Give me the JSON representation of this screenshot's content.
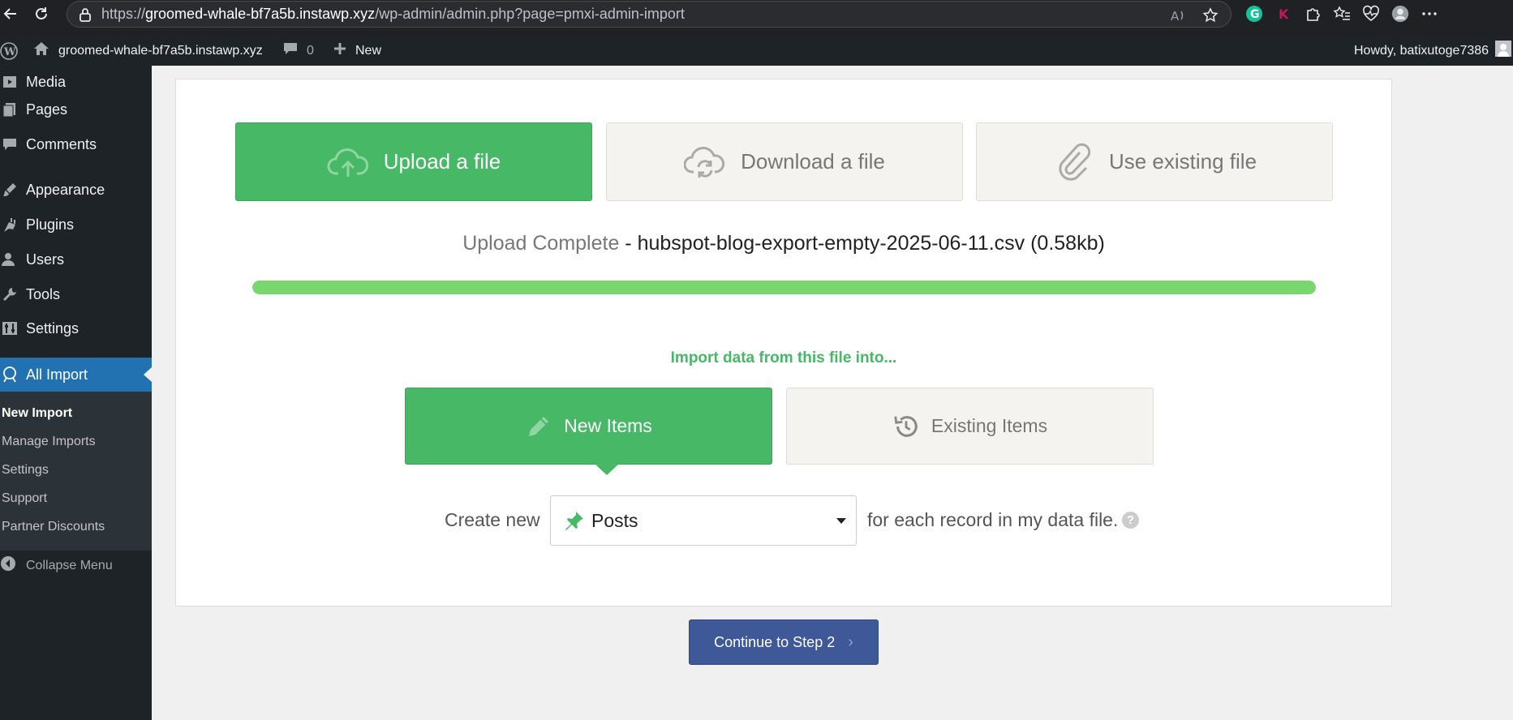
{
  "browser": {
    "url_scheme": "https://",
    "url_host": "groomed-whale-bf7a5b.instawp.xyz",
    "url_path": "/wp-admin/admin.php?page=pmxi-admin-import"
  },
  "admin_bar": {
    "site_name": "groomed-whale-bf7a5b.instawp.xyz",
    "comments_count": "0",
    "new_label": "New",
    "howdy": "Howdy, batixutoge7386"
  },
  "sidebar": {
    "items": [
      {
        "label": "Media",
        "icon": "media-icon"
      },
      {
        "label": "Pages",
        "icon": "pages-icon"
      },
      {
        "label": "Comments",
        "icon": "comments-icon"
      },
      {
        "label": "Appearance",
        "icon": "appearance-icon"
      },
      {
        "label": "Plugins",
        "icon": "plugins-icon"
      },
      {
        "label": "Users",
        "icon": "users-icon"
      },
      {
        "label": "Tools",
        "icon": "tools-icon"
      },
      {
        "label": "Settings",
        "icon": "settings-icon"
      },
      {
        "label": "All Import",
        "icon": "all-import-icon"
      }
    ],
    "submenu": [
      "New Import",
      "Manage Imports",
      "Settings",
      "Support",
      "Partner Discounts"
    ],
    "collapse_label": "Collapse Menu"
  },
  "import": {
    "upload_btn": "Upload a file",
    "download_btn": "Download a file",
    "existing_btn": "Use existing file",
    "upload_complete": "Upload Complete",
    "file_info": " - hubspot-blog-export-empty-2025-06-11.csv (0.58kb)",
    "progress_percent": 100,
    "import_into": "Import data from this file into...",
    "new_items": "New Items",
    "existing_items": "Existing Items",
    "create_new": "Create new",
    "post_type": "Posts",
    "for_each": "for each record in my data file.",
    "help": "?",
    "continue": "Continue to Step 2",
    "continue_chevron": "›"
  },
  "colors": {
    "accent_green": "#46b866",
    "progress_green": "#7ad66f",
    "wp_blue": "#2271b1",
    "continue_blue": "#3e5898"
  }
}
